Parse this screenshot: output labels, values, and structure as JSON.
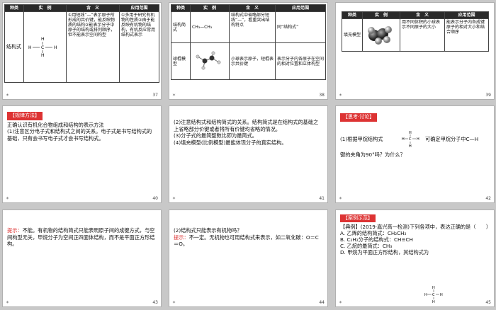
{
  "s37": {
    "headers": [
      "种类",
      "实　例",
      "含　义",
      "应用范围"
    ],
    "row_label": "结构式",
    "meaning": "①用短线“—”表示原子所形成的共价键，能反映物质的结构②能表示分子中原子的结构或排列顺序，但不能表示空间构型",
    "scope": "①多用于研究有机物的性质②由于能反映有机物的结构，有机反应常用结构式表示",
    "num": "37"
  },
  "s38": {
    "headers": [
      "种类",
      "实　例",
      "含　义",
      "应用范围"
    ],
    "row1_label": "结构简式",
    "row1_example": "CH₃—CH₃",
    "row1_meaning": "结构式中省略部分短线“—”，看重突出结构特点",
    "row1_scope": "同“结构式”",
    "row2_label": "球棍模型",
    "row2_meaning": "小球表示原子，短棍表示共价键",
    "row2_scope": "表示分子内各原子在空间的相对位置和立体构型",
    "num": "38"
  },
  "s39": {
    "headers": [
      "种类",
      "实　例",
      "含　义",
      "应用范围"
    ],
    "row_label": "填充模型",
    "meaning": "用不同体积的小球表示不同原子的大小",
    "scope": "能表示分子内各成键原子的相对大小和结合顺序",
    "num": "39"
  },
  "s40": {
    "tag": "【规律方法】",
    "lines": [
      "正确认识有机化合物组成和结构的表示方法",
      "(1)注意区分电子式和结构式之间的关系。电子式是书写结构式的基础，只有会书写电子式才会书写结构式。"
    ],
    "num": "40"
  },
  "s41": {
    "lines": [
      "(2)注意结构式和结构简式的关系。结构简式是在结构式的基础之上省略部分价键或者将所有价键均省略的情况。",
      "(3)分子式的最简整数比即为最简式。",
      "(4)填充模型(比例模型)最能体现分子的真实结构。"
    ],
    "num": "41"
  },
  "s42": {
    "tag": "【思考·讨论】",
    "q1": "(1)根据甲烷结构式",
    "q2": "可确定甲烷分子中C—H",
    "q3": "键的夹角为90°吗？为什么？",
    "num": "42"
  },
  "s43": {
    "prefix": "提示：",
    "text": "不能。有机物的结构简式只能表明原子间的成键方式，与空间构型无关，甲烷分子为空间正四面体结构，而不是平面正方形结构。",
    "num": "43"
  },
  "s44": {
    "q": "(2)结构式只能表示有机物吗？",
    "prefix": "提示：",
    "text": "不一定。无机物也可用结构式来表示，如二氧化碳：O＝C＝O。",
    "num": "44"
  },
  "s45": {
    "tag": "【案例示范】",
    "title": "【典例】(2019·嘉兴高一检测)下列各项中，表达正确的是（　　）",
    "options": [
      "A. 乙烯的结构简式：CH₂CH₂",
      "B. C₂H₂分子的结构式：CH≡CH",
      "C. 乙烷的最简式：CH₃",
      "D. 甲烷为平面正方形结构，其结构式为"
    ],
    "num": "45"
  },
  "methane_atoms": {
    "c": "C",
    "h": "H"
  },
  "colors": {
    "accent": "#dd3333",
    "header": "#2a2a2a"
  }
}
